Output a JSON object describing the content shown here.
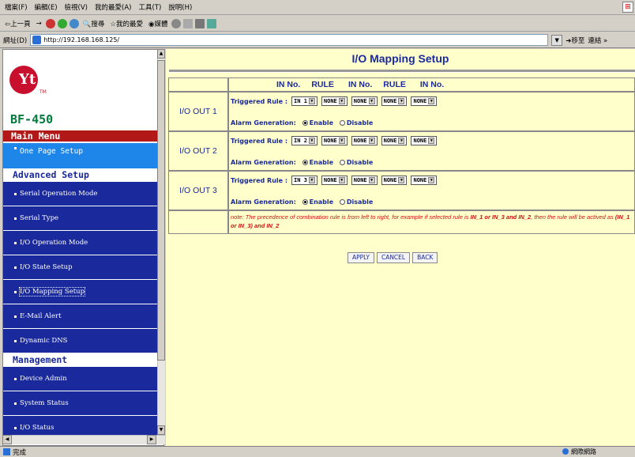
{
  "menubar": {
    "items": [
      "檔案(F)",
      "編輯(E)",
      "檢視(V)",
      "我的最愛(A)",
      "工具(T)",
      "說明(H)"
    ]
  },
  "toolbar": {
    "back": "上一頁",
    "forward": "→",
    "search": "搜尋",
    "favorites": "我的最愛",
    "media": "媒體"
  },
  "address": {
    "label": "網址(D)",
    "url": "http://192.168.168.125/",
    "go": "移至",
    "links": "連結"
  },
  "sidebar": {
    "logo_text": "Yt",
    "trademark": "TM",
    "model": "BF-450",
    "main_menu": "Main Menu",
    "one_page_setup": "One Page Setup",
    "advanced_setup": "Advanced Setup",
    "advanced_items": [
      "Serial Operation Mode",
      "Serial Type",
      "I/O Operation Mode",
      "I/O State Setup",
      "I/O Mapping Setup",
      "E-Mail Alert",
      "Dynamic DNS"
    ],
    "management": "Management",
    "management_items": [
      "Device Admin",
      "System Status",
      "I/O Status"
    ]
  },
  "page": {
    "title": "I/O Mapping Setup",
    "header": [
      "IN No.",
      "RULE",
      "IN No.",
      "RULE",
      "IN No."
    ],
    "triggered_label": "Triggered Rule :",
    "alarm_label": "Alarm Generation:",
    "enable": "Enable",
    "disable": "Disable",
    "outputs": [
      {
        "label": "I/O OUT 1",
        "values": [
          "IN 1",
          "NONE",
          "NONE",
          "NONE",
          "NONE"
        ],
        "alarm": "Enable"
      },
      {
        "label": "I/O OUT 2",
        "values": [
          "IN 2",
          "NONE",
          "NONE",
          "NONE",
          "NONE"
        ],
        "alarm": "Enable"
      },
      {
        "label": "I/O OUT 3",
        "values": [
          "IN 3",
          "NONE",
          "NONE",
          "NONE",
          "NONE"
        ],
        "alarm": "Enable"
      }
    ],
    "note_pre": "note: The precedence of combination rule is from left to right, for example if selected rule is ",
    "note_ex1": "IN_1 or IN_3 and IN_2",
    "note_mid": ", then the rule will be actived as ",
    "note_ex2": "(IN_1 or IN_3) and IN_2",
    "buttons": {
      "apply": "APPLY",
      "cancel": "CANCEL",
      "back": "BACK"
    }
  },
  "status": {
    "left": "完成",
    "zone": "網際網路"
  },
  "colors": {
    "accent_blue": "#1a2a9c",
    "nav_bg": "#1a2a9c",
    "active_nav": "#1e86e8",
    "main_menu_bg": "#b21818",
    "content_bg": "#ffffcc",
    "note_red": "#d01010"
  }
}
